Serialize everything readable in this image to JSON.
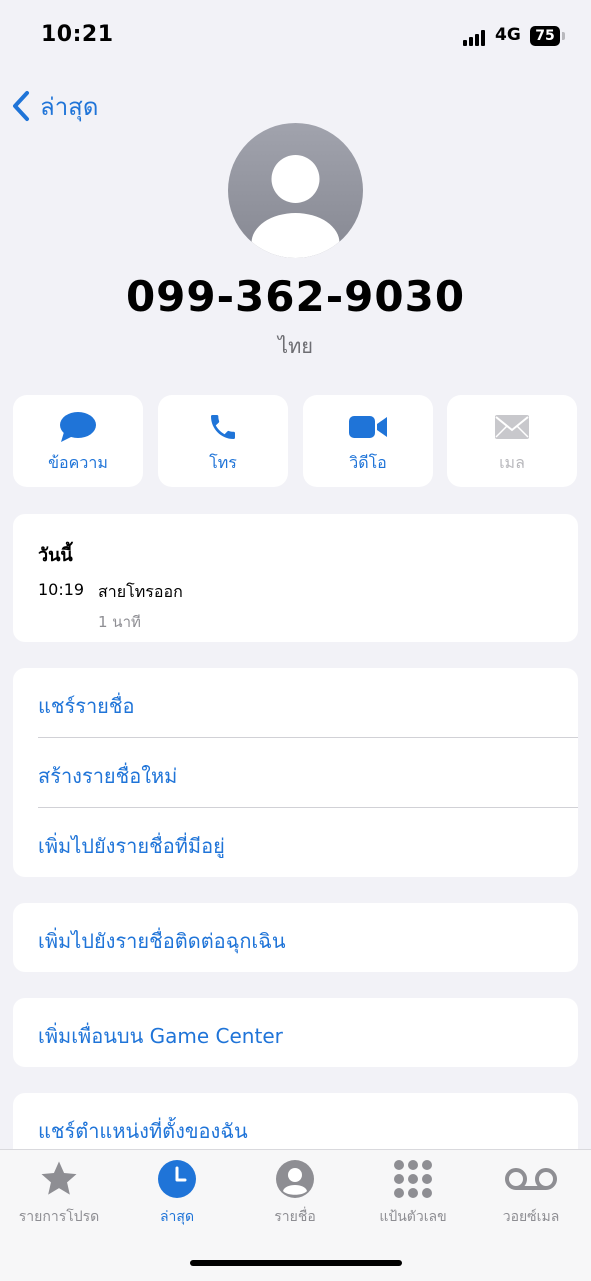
{
  "status": {
    "time": "10:21",
    "network": "4G",
    "battery": "75"
  },
  "nav": {
    "back_label": "ล่าสุด"
  },
  "contact": {
    "number": "099-362-9030",
    "region": "ไทย"
  },
  "actions": [
    {
      "label": "ข้อความ",
      "icon": "message-icon",
      "enabled": true
    },
    {
      "label": "โทร",
      "icon": "phone-icon",
      "enabled": true
    },
    {
      "label": "วิดีโอ",
      "icon": "video-icon",
      "enabled": true
    },
    {
      "label": "เมล",
      "icon": "mail-icon",
      "enabled": false
    }
  ],
  "history": {
    "heading": "วันนี้",
    "entries": [
      {
        "time": "10:19",
        "type": "สายโทรออก",
        "duration": "1 นาที"
      }
    ]
  },
  "options": {
    "share_contact": "แชร์รายชื่อ",
    "create_contact": "สร้างรายชื่อใหม่",
    "add_existing": "เพิ่มไปยังรายชื่อที่มีอยู่",
    "add_emergency": "เพิ่มไปยังรายชื่อติดต่อฉุกเฉิน",
    "add_game_center": "เพิ่มเพื่อนบน Game Center",
    "share_location": "แชร์ตำแหน่งที่ตั้งของฉัน"
  },
  "tabs": [
    {
      "label": "รายการโปรด",
      "icon": "star-icon",
      "active": false
    },
    {
      "label": "ล่าสุด",
      "icon": "clock-icon",
      "active": true
    },
    {
      "label": "รายชื่อ",
      "icon": "person-icon",
      "active": false
    },
    {
      "label": "แป้นตัวเลข",
      "icon": "keypad-icon",
      "active": false
    },
    {
      "label": "วอยซ์เมล",
      "icon": "voicemail-icon",
      "active": false
    }
  ],
  "colors": {
    "accent": "#1f74d8",
    "background": "#f2f2f7",
    "card": "#ffffff",
    "inactive": "#8e8e93"
  }
}
